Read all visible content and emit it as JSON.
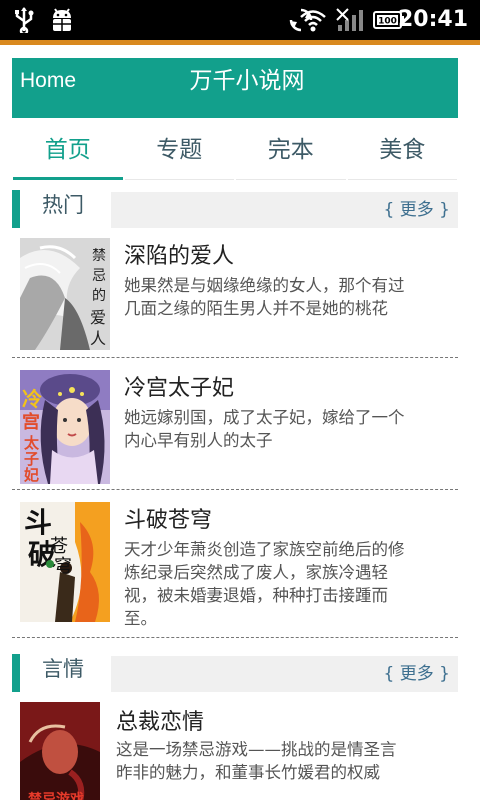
{
  "status_bar": {
    "time": "20:41",
    "icons": [
      "usb-icon",
      "android-debug-icon",
      "sync-icon",
      "wifi-icon",
      "signal-icon",
      "battery-icon"
    ]
  },
  "header": {
    "home_label": "Home",
    "site_title": "万千小说网",
    "color": "#12a08c"
  },
  "tabs": [
    {
      "label": "首页",
      "active": true
    },
    {
      "label": "专题",
      "active": false
    },
    {
      "label": "完本",
      "active": false
    },
    {
      "label": "美食",
      "active": false
    }
  ],
  "sections": [
    {
      "name": "热门",
      "more": "{ 更多 }",
      "books": [
        {
          "title": "深陷的爱人",
          "desc": "她果然是与姻缘绝缘的女人，那个有过几面之缘的陌生男人并不是她的桃花",
          "cover_text": "禁忌的爱人"
        },
        {
          "title": "冷宫太子妃",
          "desc": "她远嫁别国，成了太子妃，嫁给了一个内心早有别人的太子",
          "cover_text": "冷宫太子妃"
        },
        {
          "title": "斗破苍穹",
          "desc": "天才少年萧炎创造了家族空前绝后的修炼纪录后突然成了废人，家族冷遇轻视，被未婚妻退婚，种种打击接踵而至。",
          "cover_text": "斗破苍穹"
        }
      ]
    },
    {
      "name": "言情",
      "more": "{ 更多 }",
      "books": [
        {
          "title": "总裁恋情",
          "desc": "这是一场禁忌游戏——挑战的是情圣言昨非的魅力，和董事长竹媛君的权威",
          "cover_text": "禁忌游戏"
        }
      ]
    }
  ]
}
